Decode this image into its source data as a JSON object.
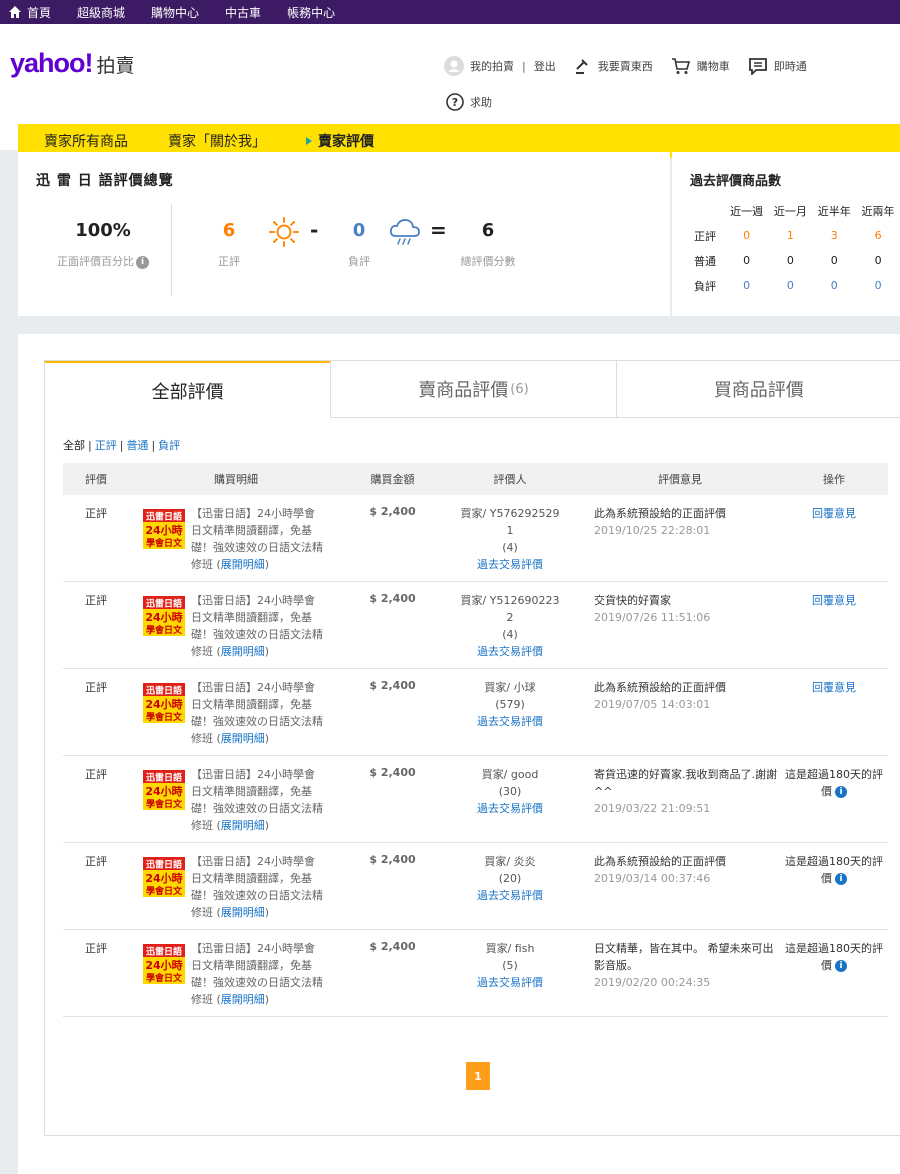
{
  "topnav": {
    "items": [
      "首頁",
      "超級商城",
      "購物中心",
      "中古車",
      "帳務中心"
    ]
  },
  "header": {
    "logo_text": "yahoo!",
    "logo_sub": "拍賣",
    "my_auction": "我的拍賣",
    "separator": "|",
    "logout": "登出",
    "sell": "我要賣東西",
    "cart": "購物車",
    "messenger": "即時通",
    "help": "求助"
  },
  "seller_tabs": {
    "all_items": "賣家所有商品",
    "about_me": "賣家「關於我」",
    "ratings": "賣家評價"
  },
  "overview": {
    "title": "迅 雷 日 語評價總覽",
    "positive_pct": "100%",
    "positive_pct_label": "正面評價百分比",
    "positive": "6",
    "positive_label": "正評",
    "minus": "-",
    "negative": "0",
    "negative_label": "負評",
    "equals": "=",
    "total": "6",
    "total_label": "總評價分數"
  },
  "history": {
    "title": "過去評價商品數",
    "columns": [
      "近一週",
      "近一月",
      "近半年",
      "近兩年"
    ],
    "rows": [
      {
        "label": "正評",
        "values": [
          "0",
          "1",
          "3",
          "6"
        ]
      },
      {
        "label": "普通",
        "values": [
          "0",
          "0",
          "0",
          "0"
        ]
      },
      {
        "label": "負評",
        "values": [
          "0",
          "0",
          "0",
          "0"
        ]
      }
    ]
  },
  "tabs": {
    "all": "全部評價",
    "sell": "賣商品評價",
    "sell_count": "(6)",
    "buy": "買商品評價"
  },
  "filters": {
    "all": "全部",
    "positive": "正評",
    "neutral": "普通",
    "negative": "負評",
    "bar": "|"
  },
  "table": {
    "headers": [
      "評價",
      "購買明細",
      "購買金額",
      "評價人",
      "評價意見",
      "操作"
    ],
    "rows": [
      {
        "rating": "正評",
        "desc": "【迅雷日語】24小時學會日文精準閱讀翻譯，免基礎！強效速效の日語文法精修班 (",
        "expand": "展開明細",
        "close": ")",
        "price": "$ 2,400",
        "rater": "買家/ Y576292529",
        "rater2": "1",
        "rater_score": "(4)",
        "rater_link": "過去交易評價",
        "comment": "此為系統預設給的正面評價",
        "date": "2019/10/25 22:28:01",
        "op_link": "回覆意見",
        "op_text": ""
      },
      {
        "rating": "正評",
        "desc": "【迅雷日語】24小時學會日文精準閱讀翻譯，免基礎！強效速效の日語文法精修班 (",
        "expand": "展開明細",
        "close": ")",
        "price": "$ 2,400",
        "rater": "買家/ Y512690223",
        "rater2": "2",
        "rater_score": "(4)",
        "rater_link": "過去交易評價",
        "comment": "交貨快的好賣家",
        "date": "2019/07/26 11:51:06",
        "op_link": "回覆意見",
        "op_text": ""
      },
      {
        "rating": "正評",
        "desc": "【迅雷日語】24小時學會日文精準閱讀翻譯，免基礎！強效速效の日語文法精修班 (",
        "expand": "展開明細",
        "close": ")",
        "price": "$ 2,400",
        "rater": "買家/ 小球",
        "rater2": "",
        "rater_score": "(579)",
        "rater_link": "過去交易評價",
        "comment": "此為系統預設給的正面評價",
        "date": "2019/07/05 14:03:01",
        "op_link": "回覆意見",
        "op_text": ""
      },
      {
        "rating": "正評",
        "desc": "【迅雷日語】24小時學會日文精準閱讀翻譯，免基礎！強效速效の日語文法精修班 (",
        "expand": "展開明細",
        "close": ")",
        "price": "$ 2,400",
        "rater": "買家/ good",
        "rater2": "",
        "rater_score": "(30)",
        "rater_link": "過去交易評價",
        "comment": "寄貨迅速的好賣家.我收到商品了.謝謝^^",
        "date": "2019/03/22 21:09:51",
        "op_link": "",
        "op_text": "這是超過180天的評價"
      },
      {
        "rating": "正評",
        "desc": "【迅雷日語】24小時學會日文精準閱讀翻譯，免基礎！強效速效の日語文法精修班 (",
        "expand": "展開明細",
        "close": ")",
        "price": "$ 2,400",
        "rater": "買家/ 炎炎",
        "rater2": "",
        "rater_score": "(20)",
        "rater_link": "過去交易評價",
        "comment": "此為系統預設給的正面評價",
        "date": "2019/03/14 00:37:46",
        "op_link": "",
        "op_text": "這是超過180天的評價"
      },
      {
        "rating": "正評",
        "desc": "【迅雷日語】24小時學會日文精準閱讀翻譯，免基礎！強效速效の日語文法精修班 (",
        "expand": "展開明細",
        "close": ")",
        "price": "$ 2,400",
        "rater": "買家/ fish",
        "rater2": "",
        "rater_score": "(5)",
        "rater_link": "過去交易評價",
        "comment": "日文精華，皆在其中。 希望未來可出影音版。",
        "date": "2019/02/20 00:24:35",
        "op_link": "",
        "op_text": "這是超過180天的評價"
      }
    ]
  },
  "thumb": {
    "line1": "迅雷日語",
    "line2": "24小時",
    "line3": "學會日文"
  },
  "pagination": {
    "current": "1"
  },
  "colors": {
    "topnav": "#3c1a64",
    "brand": "#6001d2",
    "yellow": "#ffe000",
    "orange": "#ff7f00",
    "link": "#1a73c7"
  }
}
